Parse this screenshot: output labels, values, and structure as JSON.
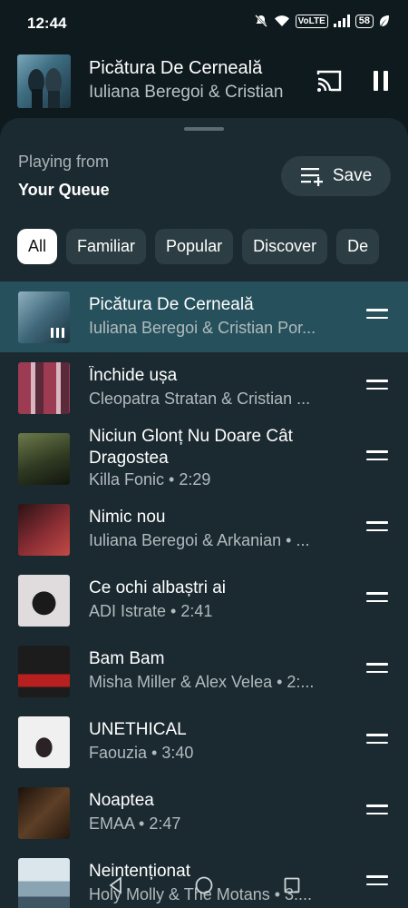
{
  "status": {
    "time": "12:44",
    "volte": "VoLTE",
    "battery": "58"
  },
  "mini_player": {
    "title": "Picătura De Cerneală",
    "artist": "Iuliana Beregoi & Cristian"
  },
  "header": {
    "playing_from_label": "Playing from",
    "queue_name": "Your Queue",
    "save_label": "Save"
  },
  "chips": [
    {
      "label": "All",
      "active": true
    },
    {
      "label": "Familiar",
      "active": false
    },
    {
      "label": "Popular",
      "active": false
    },
    {
      "label": "Discover",
      "active": false
    },
    {
      "label": "De",
      "active": false
    }
  ],
  "queue": [
    {
      "title": "Picătura De Cerneală",
      "subtitle": "Iuliana Beregoi & Cristian Por...",
      "art": "#5d8294",
      "current": true
    },
    {
      "title": "Închide ușa",
      "subtitle": "Cleopatra Stratan & Cristian ...",
      "art": "#8b3a4d"
    },
    {
      "title": "Niciun Glonț Nu Doare Cât Dragostea",
      "subtitle": "Killa Fonic • 2:29",
      "art": "#3e4a2b"
    },
    {
      "title": "Nimic nou",
      "subtitle": "Iuliana Beregoi & Arkanian • ...",
      "art": "#6a2a2f"
    },
    {
      "title": "Ce ochi albaștri ai",
      "subtitle": "ADI Istrate • 2:41",
      "art": "#d8d4d6"
    },
    {
      "title": "Bam Bam",
      "subtitle": "Misha Miller & Alex Velea • 2:...",
      "art": "#7a1c1c"
    },
    {
      "title": "UNETHICAL",
      "subtitle": "Faouzia • 3:40",
      "art": "#e9e9e9"
    },
    {
      "title": "Noaptea",
      "subtitle": "EMAA • 2:47",
      "art": "#3a2a1c"
    },
    {
      "title": "Neintenționat",
      "subtitle": "Holy Molly & The Motans • 3:...",
      "art": "#c9d7e0"
    }
  ]
}
